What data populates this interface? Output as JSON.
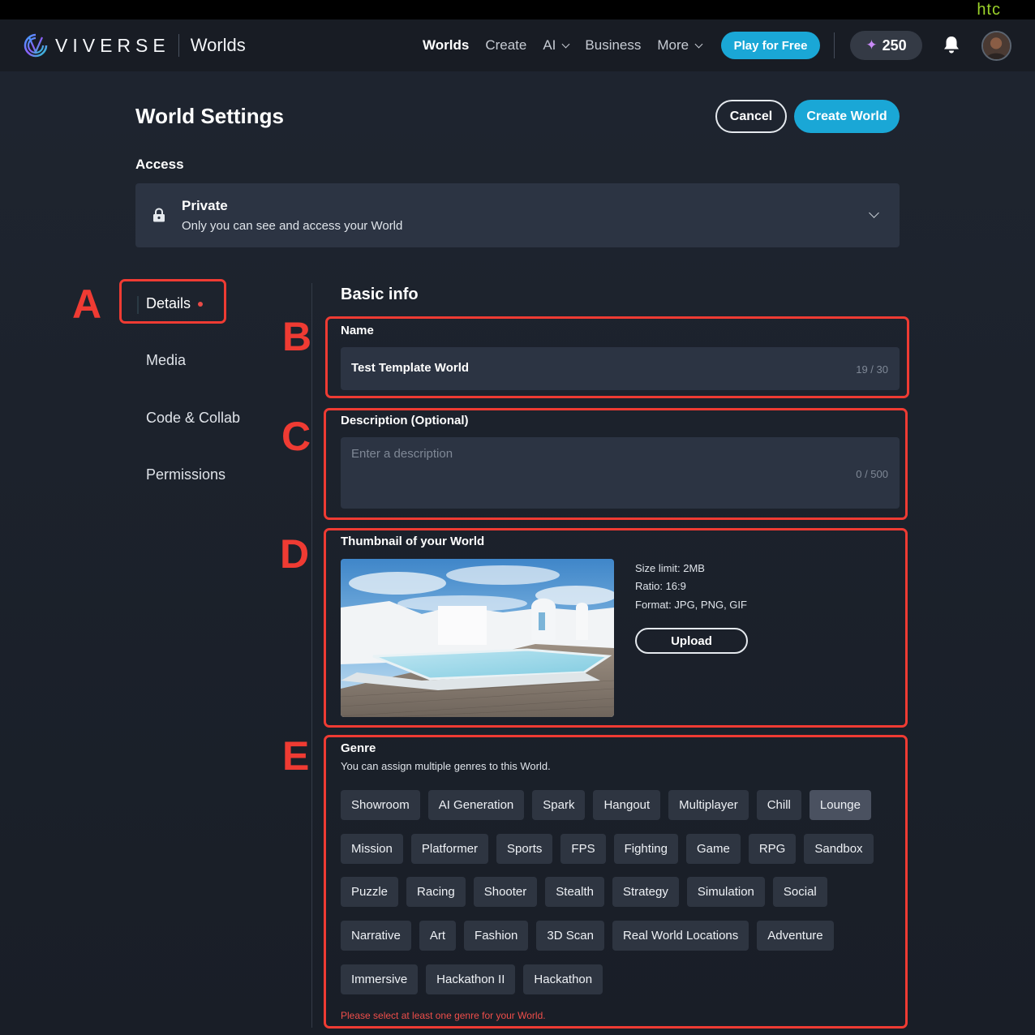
{
  "topbar": {
    "brand_logo": "HTC"
  },
  "header": {
    "brand": "VIVERSE",
    "product": "Worlds",
    "nav": [
      {
        "label": "Worlds",
        "active": true,
        "dropdown": false
      },
      {
        "label": "Create",
        "active": false,
        "dropdown": false
      },
      {
        "label": "AI",
        "active": false,
        "dropdown": true
      },
      {
        "label": "Business",
        "active": false,
        "dropdown": false
      },
      {
        "label": "More",
        "active": false,
        "dropdown": true
      }
    ],
    "play_button": "Play for Free",
    "credits": "250",
    "credits_icon": "sparkle-icon",
    "notifications_icon": "bell-icon",
    "avatar_icon": "user-avatar",
    "accent_color": "#1aa7d6"
  },
  "page": {
    "title": "World Settings",
    "cancel_label": "Cancel",
    "create_label": "Create World"
  },
  "access": {
    "label": "Access",
    "title": "Private",
    "description": "Only you can see and access your World",
    "icon": "lock-icon"
  },
  "sidebar": {
    "items": [
      {
        "label": "Details",
        "active": true,
        "has_indicator": true
      },
      {
        "label": "Media",
        "active": false
      },
      {
        "label": "Code & Collab",
        "active": false
      },
      {
        "label": "Permissions",
        "active": false
      }
    ]
  },
  "basic_info": {
    "title": "Basic info",
    "name_label": "Name",
    "name_value": "Test Template World",
    "name_counter": "19 / 30",
    "description_label": "Description (Optional)",
    "description_placeholder": "Enter a description",
    "description_counter": "0 / 500",
    "thumbnail_label": "Thumbnail of your World",
    "size_limit": "Size limit: 2MB",
    "ratio": "Ratio: 16:9",
    "format": "Format: JPG, PNG, GIF",
    "upload_label": "Upload"
  },
  "genre": {
    "label": "Genre",
    "subtitle": "You can assign multiple genres to this World.",
    "rows": [
      [
        "Showroom",
        "AI Generation",
        "Spark",
        "Hangout",
        "Multiplayer",
        "Chill",
        "Lounge"
      ],
      [
        "Mission",
        "Platformer",
        "Sports",
        "FPS",
        "Fighting",
        "Game",
        "RPG",
        "Sandbox"
      ],
      [
        "Puzzle",
        "Racing",
        "Shooter",
        "Stealth",
        "Strategy",
        "Simulation",
        "Social"
      ],
      [
        "Narrative",
        "Art",
        "Fashion",
        "3D Scan",
        "Real World Locations",
        "Adventure"
      ],
      [
        "Immersive",
        "Hackathon II",
        "Hackathon"
      ]
    ],
    "highlighted": "Lounge",
    "error": "Please select at least one genre for your World."
  },
  "annotations": {
    "letters": [
      "A",
      "B",
      "C",
      "D",
      "E"
    ],
    "color": "#ef3b33"
  }
}
